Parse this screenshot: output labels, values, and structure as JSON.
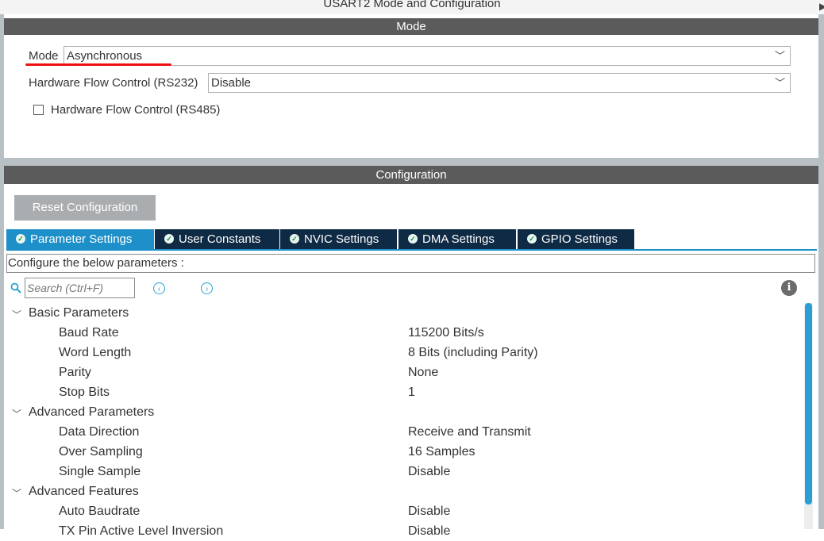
{
  "window": {
    "title": "USART2 Mode and Configuration"
  },
  "mode_section": {
    "header": "Mode",
    "mode_label": "Mode",
    "mode_value": "Asynchronous",
    "hw_flow_rs232_label": "Hardware Flow Control (RS232)",
    "hw_flow_rs232_value": "Disable",
    "hw_flow_rs485_label": "Hardware Flow Control (RS485)",
    "hw_flow_rs485_checked": false
  },
  "config_section": {
    "header": "Configuration",
    "reset_label": "Reset Configuration",
    "tabs": [
      {
        "label": "Parameter Settings",
        "active": true
      },
      {
        "label": "User Constants",
        "active": false
      },
      {
        "label": "NVIC Settings",
        "active": false
      },
      {
        "label": "DMA Settings",
        "active": false
      },
      {
        "label": "GPIO Settings",
        "active": false
      }
    ],
    "description": "Configure the below parameters :",
    "search_placeholder": "Search (Ctrl+F)",
    "groups": [
      {
        "name": "Basic Parameters",
        "params": [
          {
            "name": "Baud Rate",
            "value": "115200 Bits/s"
          },
          {
            "name": "Word Length",
            "value": "8 Bits (including Parity)"
          },
          {
            "name": "Parity",
            "value": "None"
          },
          {
            "name": "Stop Bits",
            "value": "1"
          }
        ]
      },
      {
        "name": "Advanced Parameters",
        "params": [
          {
            "name": "Data Direction",
            "value": "Receive and Transmit"
          },
          {
            "name": "Over Sampling",
            "value": "16 Samples"
          },
          {
            "name": "Single Sample",
            "value": "Disable"
          }
        ]
      },
      {
        "name": "Advanced Features",
        "params": [
          {
            "name": "Auto Baudrate",
            "value": "Disable"
          },
          {
            "name": "TX Pin Active Level Inversion",
            "value": "Disable"
          }
        ]
      }
    ]
  },
  "colors": {
    "accent": "#1d8fc9",
    "tab_dark": "#0f2a44",
    "header_gray": "#5b5b5b",
    "annotation_red": "#e11111"
  }
}
